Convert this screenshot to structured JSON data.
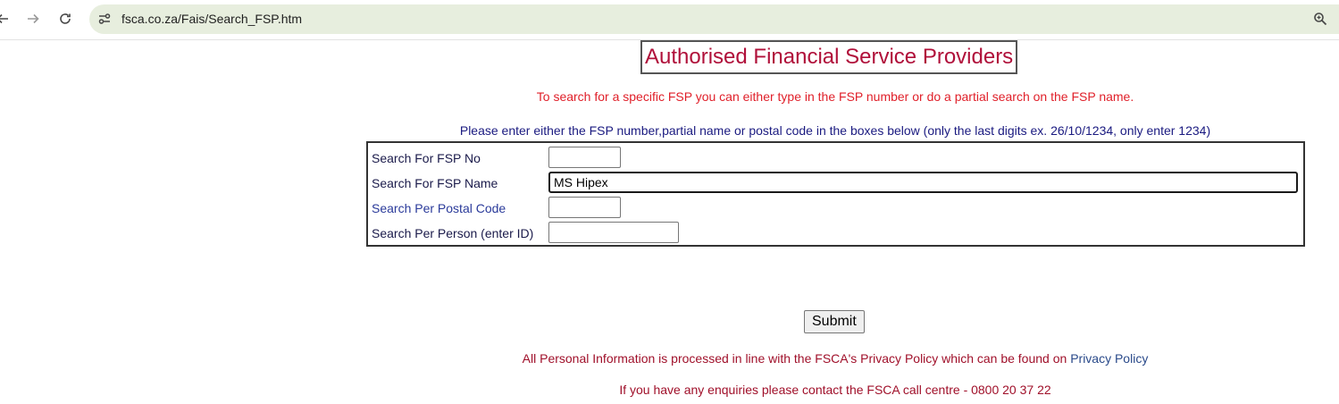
{
  "browser": {
    "url": "fsca.co.za/Fais/Search_FSP.htm"
  },
  "page": {
    "title": "Authorised Financial Service Providers",
    "intro": "To search for a specific FSP you can either type in the FSP number or do a partial search on the FSP name.",
    "instructions": "Please enter either the FSP number,partial name or postal code in the boxes below (only the last digits ex. 26/10/1234, only enter 1234)"
  },
  "form": {
    "fsp_no_label": "Search For FSP No",
    "fsp_no_value": "",
    "fsp_name_label": "Search For FSP Name",
    "fsp_name_value": "MS Hipex",
    "postal_code_label": "Search Per Postal Code",
    "postal_code_value": "",
    "person_label": "Search Per Person (enter ID)",
    "person_value": "",
    "submit_label": "Submit"
  },
  "footer": {
    "privacy_text": "All Personal Information is processed in line with the FSCA's Privacy Policy which can be found on ",
    "privacy_link": "Privacy Policy",
    "enquiries": "If you have any enquiries please contact the FSCA call centre - 0800 20 37 22"
  },
  "colors": {
    "title": "#b0103a",
    "intro": "#e0202a",
    "instructions": "#1a1a80",
    "footer": "#a0102a",
    "link": "#2a4a8a",
    "omnibox": "#e7eede"
  }
}
